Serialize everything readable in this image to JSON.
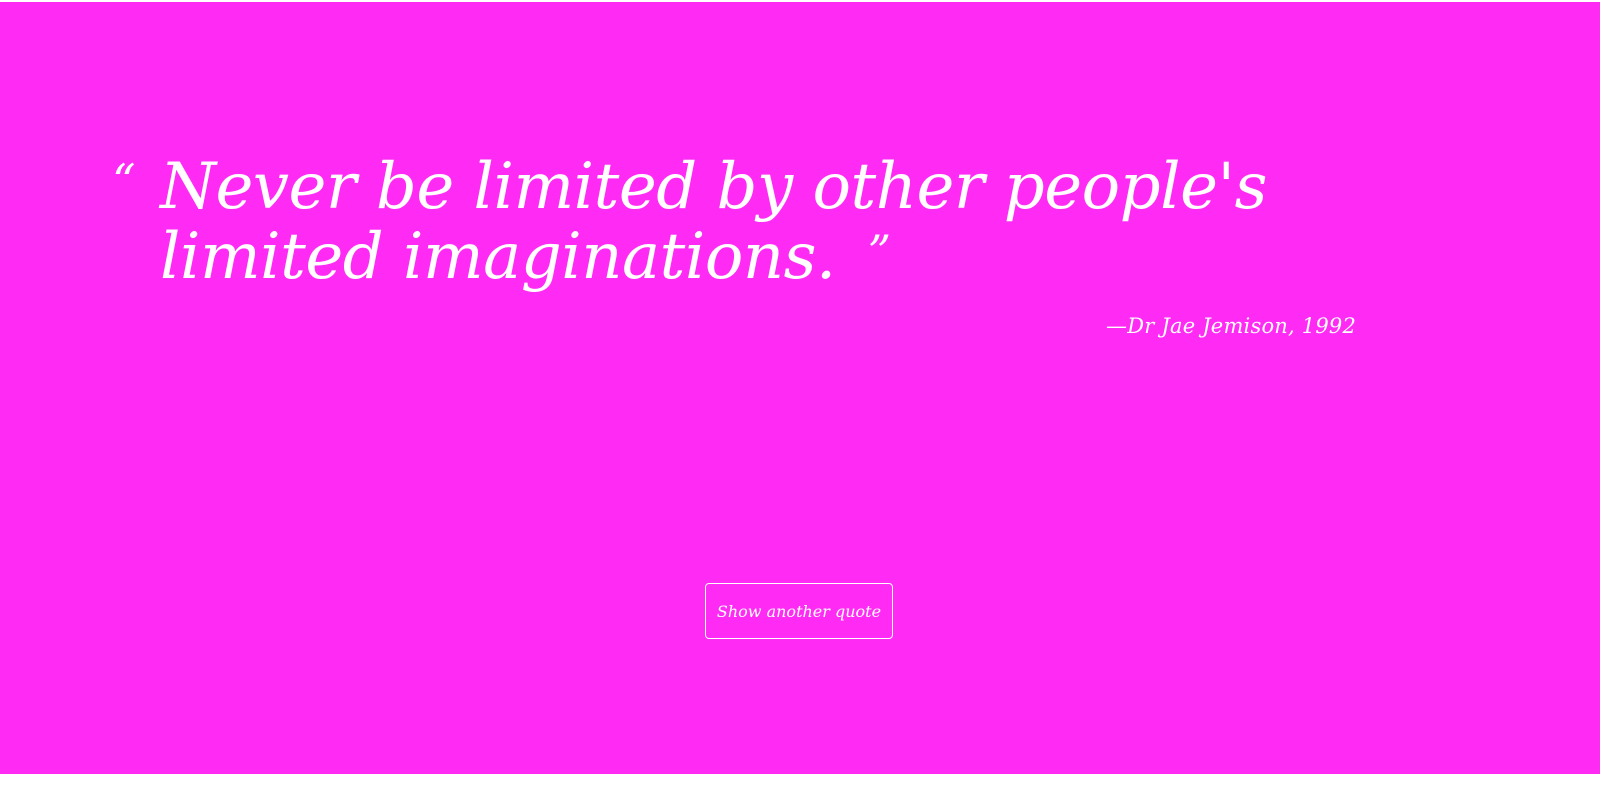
{
  "quote": {
    "open_mark": "“",
    "text": "Never be limited by other people's limited imaginations.",
    "close_mark": "”"
  },
  "author": "—Dr Jae Jemison, 1992",
  "button": {
    "label": "Show another quote"
  },
  "colors": {
    "background": "#ff2bf4",
    "text": "#ffffff"
  }
}
